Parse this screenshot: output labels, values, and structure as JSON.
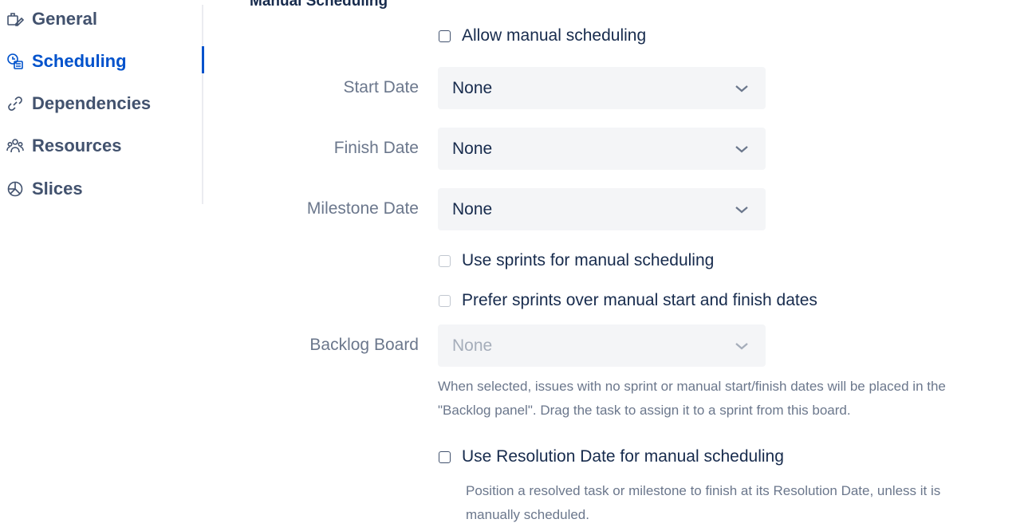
{
  "sidebar": {
    "items": [
      {
        "label": "General",
        "icon": "pen-briefcase-icon"
      },
      {
        "label": "Scheduling",
        "icon": "calendar-clock-icon",
        "active": true
      },
      {
        "label": "Dependencies",
        "icon": "link-icon"
      },
      {
        "label": "Resources",
        "icon": "people-icon"
      },
      {
        "label": "Slices",
        "icon": "pie-slices-icon"
      }
    ]
  },
  "main": {
    "section_title": "Manual Scheduling",
    "allow_manual": {
      "label": "Allow manual scheduling",
      "checked": false
    },
    "start_date": {
      "label": "Start Date",
      "value": "None"
    },
    "finish_date": {
      "label": "Finish Date",
      "value": "None"
    },
    "milestone_date": {
      "label": "Milestone Date",
      "value": "None"
    },
    "use_sprints": {
      "label": "Use sprints for manual scheduling",
      "checked": false,
      "disabled": true
    },
    "prefer_sprints": {
      "label": "Prefer sprints over manual start and finish dates",
      "checked": false,
      "disabled": true
    },
    "backlog_board": {
      "label": "Backlog Board",
      "value": "None",
      "disabled": true,
      "help_line1": "When selected, issues with no sprint or manual start/finish dates will be placed in the",
      "help_line2": "\"Backlog panel\". Drag the task to assign it to a sprint from this board."
    },
    "use_resolution": {
      "label": "Use Resolution Date for manual scheduling",
      "checked": false,
      "help_line1": "Position a resolved task or milestone to finish at its Resolution Date, unless it is",
      "help_line2": "manually scheduled."
    }
  },
  "colors": {
    "accent": "#0052cc",
    "text": "#172b4d",
    "muted": "#6b778c",
    "field_bg": "#f4f5f7"
  }
}
